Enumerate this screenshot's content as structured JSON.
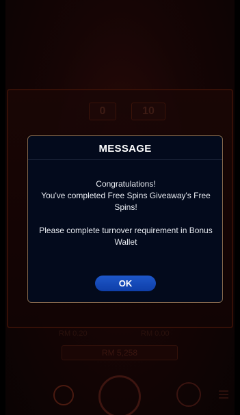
{
  "background": {
    "counter_left": "0",
    "counter_right": "10",
    "footer_left": "RM 0.20",
    "footer_right": "RM 0.00",
    "balance": "RM 5,258"
  },
  "dialog": {
    "title": "MESSAGE",
    "line1": "Congratulations!",
    "line2": "You've completed Free Spins Giveaway's Free Spins!",
    "line3": "Please complete turnover requirement in Bonus Wallet",
    "ok_label": "OK"
  },
  "colors": {
    "dialog_bg": "#030a1c",
    "dialog_border": "#8a6a4e",
    "button": "#1247b8"
  }
}
